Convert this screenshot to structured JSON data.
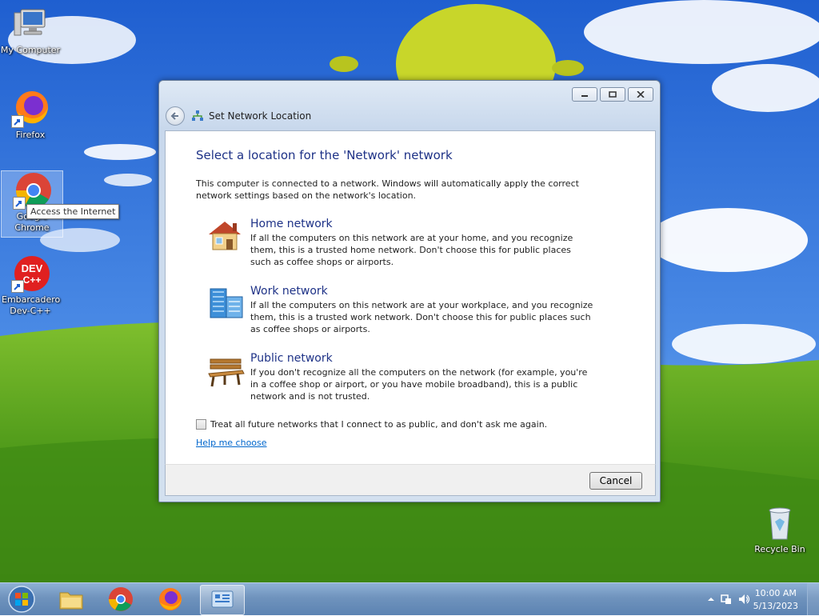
{
  "desktop": {
    "icons": [
      {
        "label": "My Computer"
      },
      {
        "label": "Firefox"
      },
      {
        "label": "Google Chrome"
      },
      {
        "label": "Embarcadero Dev-C++"
      },
      {
        "label": "Recycle Bin"
      }
    ],
    "tooltip": "Access the Internet"
  },
  "dialog": {
    "title": "Set Network Location",
    "heading": "Select a location for the 'Network' network",
    "intro": "This computer is connected to a network. Windows will automatically apply the correct network settings based on the network's location.",
    "options": [
      {
        "title": "Home network",
        "description": "If all the computers on this network are at your home, and you recognize them, this is a trusted home network.  Don't choose this for public places such as coffee shops or airports."
      },
      {
        "title": "Work network",
        "description": "If all the computers on this network are at your workplace, and you recognize them, this is a trusted work network.  Don't choose this for public places such as coffee shops or airports."
      },
      {
        "title": "Public network",
        "description": "If you don't recognize all the computers on the network (for example, you're in a coffee shop or airport, or you have mobile broadband), this is a public network and is not trusted."
      }
    ],
    "checkbox_label": "Treat all future networks that I connect to as public, and don't ask me again.",
    "checkbox_checked": false,
    "help_link": "Help me choose",
    "cancel_label": "Cancel"
  },
  "taskbar": {
    "time": "10:00 AM",
    "date": "5/13/2023"
  },
  "colors": {
    "heading": "#1e3287",
    "link": "#0066cc",
    "taskbar": "#6f93bd"
  }
}
